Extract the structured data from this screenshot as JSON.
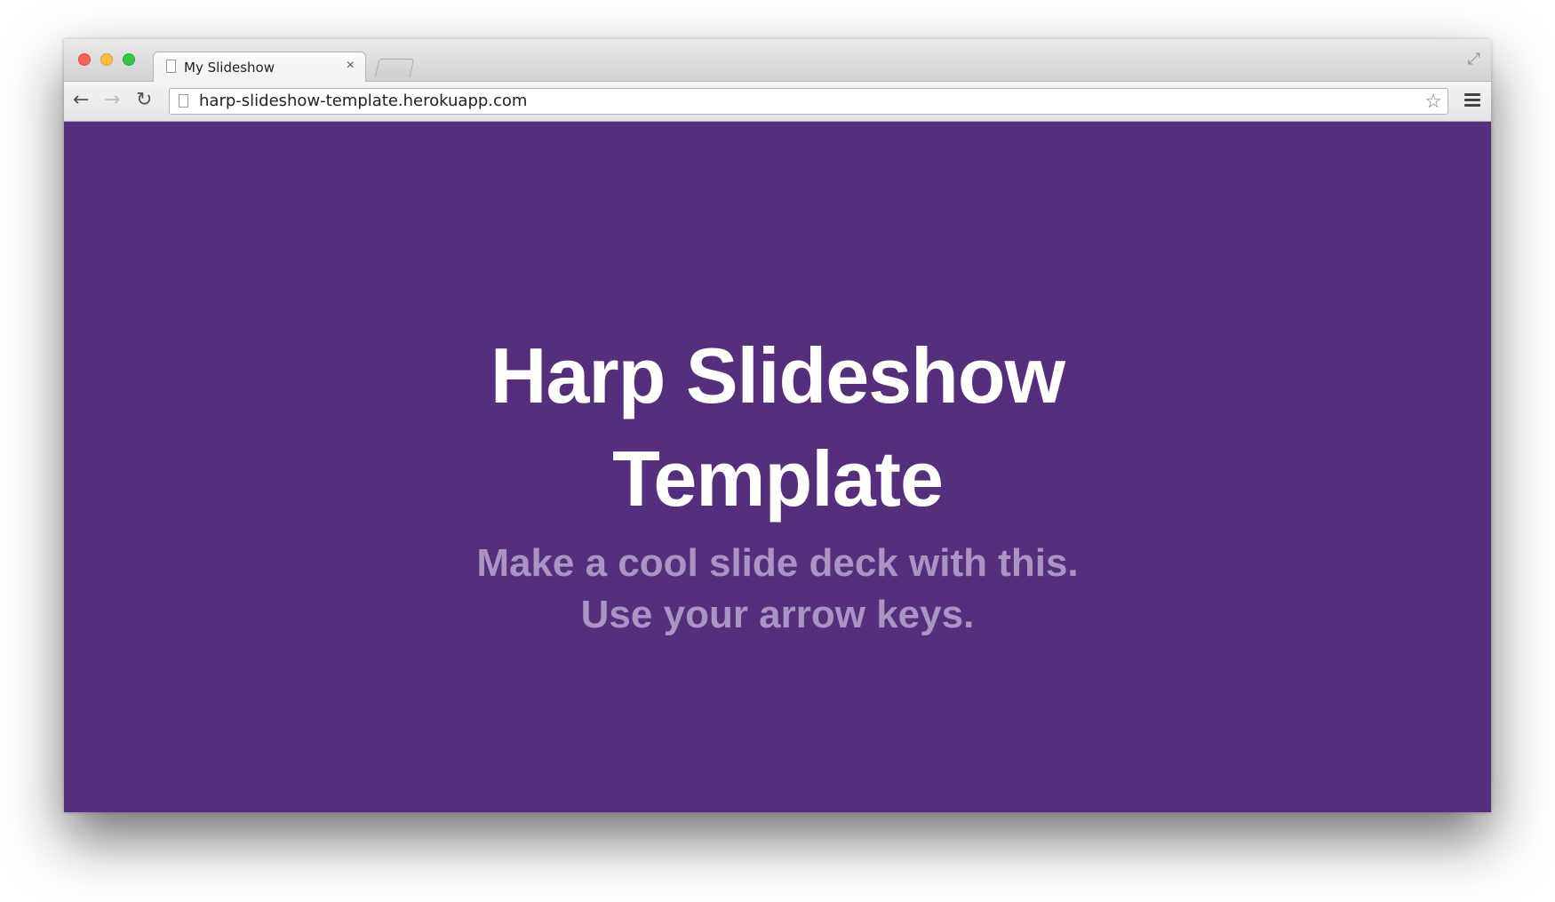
{
  "browser": {
    "tab_title": "My Slideshow",
    "tab_close": "×",
    "url": "harp-slideshow-template.herokuapp.com",
    "icons": {
      "back": "←",
      "forward": "→",
      "reload": "↻",
      "star": "☆",
      "fullscreen": "⤢"
    }
  },
  "slide": {
    "title": "Harp Slideshow Template",
    "subtitle_line1": "Make a cool slide deck with this.",
    "subtitle_line2": "Use your arrow keys."
  },
  "colors": {
    "slide_background": "#532f7c",
    "title_color": "#ffffff",
    "subtitle_color": "#a995c4"
  }
}
